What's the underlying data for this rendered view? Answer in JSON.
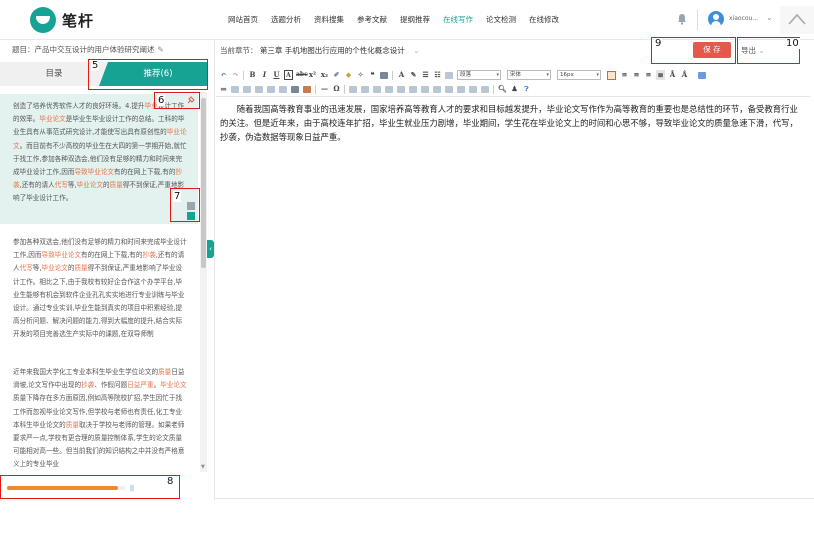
{
  "header": {
    "logo_text": "笔杆",
    "nav": [
      "网站首页",
      "选题分析",
      "资料搜集",
      "参考文献",
      "提纲推荐",
      "在线写作",
      "论文检测",
      "在线修改"
    ],
    "active_nav": "在线写作",
    "username": "xiaocou...",
    "accent_color": "#16a394"
  },
  "left": {
    "title": "题目：产品中交互设计的用户体验研究阐述",
    "tab_directory": "目录",
    "tab_recommend": "推荐(6)",
    "items": [
      {
        "parts": [
          {
            "t": "创造了培养优秀软件人才的良好环境。4.提升"
          },
          {
            "t": "毕业",
            "h": true
          },
          {
            "t": "设计工作的效率。"
          },
          {
            "t": "毕业论文",
            "h": true
          },
          {
            "t": "是毕业生毕业设计工作的总结。工科的毕业生具有从事范式研究设计,才能使写出具有原创性的"
          },
          {
            "t": "毕业论文",
            "h": true
          },
          {
            "t": "。而目前有不少高校的毕业生在大四的第一学期开始,就忙于找工作,参加各种双选会,他们没有足够的精力和时间来完成毕业设计工作,因而"
          },
          {
            "t": "导致毕业论文",
            "h": true
          },
          {
            "t": "有的在网上下载,有的"
          },
          {
            "t": "抄袭",
            "h": true
          },
          {
            "t": ",还有的请人"
          },
          {
            "t": "代写",
            "h": true
          },
          {
            "t": "等,"
          },
          {
            "t": "毕业论文",
            "h": true
          },
          {
            "t": "的"
          },
          {
            "t": "质量",
            "h": true
          },
          {
            "t": "得不到保证,严重地影响了毕业设计工作。"
          }
        ]
      },
      {
        "parts": [
          {
            "t": "参加各种双选会,他们没有足够的精力和时间来完成毕业设计工作,因而"
          },
          {
            "t": "导致毕业论文",
            "h": true
          },
          {
            "t": "有的在网上下载,有的"
          },
          {
            "t": "抄袭",
            "h": true
          },
          {
            "t": ",还有的请人"
          },
          {
            "t": "代写",
            "h": true
          },
          {
            "t": "等,"
          },
          {
            "t": "毕业论文",
            "h": true
          },
          {
            "t": "的"
          },
          {
            "t": "质量",
            "h": true
          },
          {
            "t": "得不到保证,严重地影响了毕业设计工作。相比之下,由于我校有较好企合作这个办学平台,毕业生能够有机会到软件企业孔孔实实地进行专业训练与毕业设计。通过专业实训,毕业生能到真实的项目中积累经验,提高分析问题、解决问题的能力,得到大幅度的提升,结合实际开发的项目完善选生产实际中的课题,在双导师制"
          }
        ]
      },
      {
        "parts": [
          {
            "t": "近年来我国大学化工专业本科生毕业生学位论文的"
          },
          {
            "t": "质量",
            "h": true
          },
          {
            "t": "日益滑坡,论文写作中出现的"
          },
          {
            "t": "抄袭",
            "h": true
          },
          {
            "t": "、作假问题"
          },
          {
            "t": "日益严重",
            "h": true
          },
          {
            "t": "。"
          },
          {
            "t": "毕业论文",
            "h": true
          },
          {
            "t": "质量下降存在多方面原因,例如高等院校扩招,学生因忙于找工作而忽视毕业论文写作,但学校与老师也有责任,化工专业本科生毕业论文的"
          },
          {
            "t": "质量",
            "h": true
          },
          {
            "t": "取决于学校与老师的管理。如果老师要求严一点,学校有更合理的质量控制体系,学生的论文质量可能相对高一些。但当前我们的知识结构之中并没有严格意义上的专业毕业"
          }
        ]
      }
    ],
    "progress_percent": 94,
    "progress_tail": "||"
  },
  "right": {
    "chapter_label": "当前章节：",
    "chapter_value": "第三章 手机地图出行应用的个性化概念设计",
    "save_label": "保 存",
    "export_label": "导出",
    "toolbar": {
      "paragraph_select": "段落",
      "font_select": "宋体",
      "size_select": "16px"
    },
    "body_text": "随着我国高等教育事业的迅速发展，国家培养高等教育人才的要求和目标越发提升，毕业论文写作作为高等教育的重要也是总结性的环节，备受教育行业的关注。但是近年来，由于高校连年扩招，毕业生就业压力剧增，毕业期间，学生花在毕业论文上的时间和心思不够，导致毕业论文的质量急速下滑，代写，抄袭，伪造数据等现象日益严重。"
  },
  "annotations": [
    "5",
    "6",
    "7",
    "8",
    "9",
    "10"
  ]
}
